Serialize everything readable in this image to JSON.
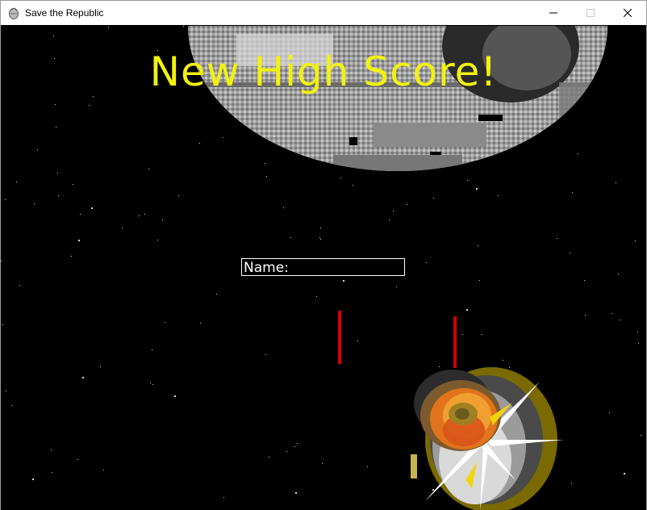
{
  "window": {
    "title": "Save the Republic",
    "controls": [
      "minimize",
      "maximize",
      "close"
    ]
  },
  "game": {
    "headline": "New High Score!",
    "name_prompt": {
      "label": "Name:",
      "value": ""
    },
    "sprites": {
      "background": "starfield",
      "planet": "death-star",
      "lasers": "red-laser-bolts",
      "effect": "explosion"
    }
  },
  "colors": {
    "headline": "#f2f20f",
    "laser": "#d40000",
    "background": "#000000",
    "planet": "#a7a7a7",
    "name_box_border": "#ffffff"
  }
}
